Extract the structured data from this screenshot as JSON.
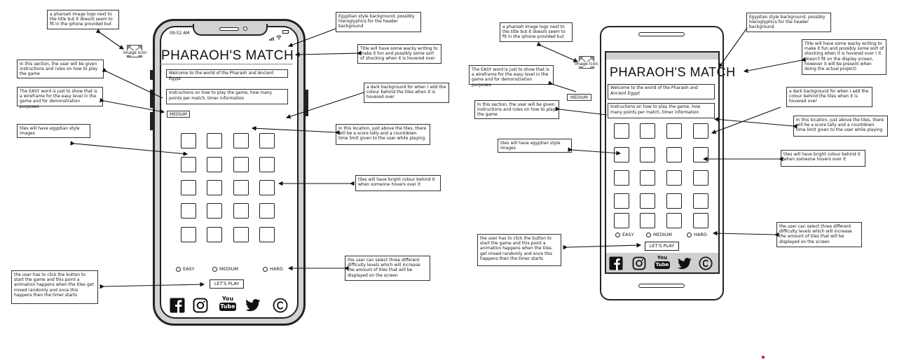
{
  "phone1": {
    "status_time": "09:52 AM",
    "image_icon_label": "Image Icon",
    "title": "PHARAOH'S MATCH",
    "welcome": "Welcome to the world of the Pharaoh and Ancient Egypt",
    "instructions": "Instructions on how to play the game, how many points per match, timer information",
    "level": "MEDIUM",
    "radio_easy": "EASY",
    "radio_medium": "MEDIUM",
    "radio_hard": "HARD",
    "play_button": "LET'S PLAY",
    "youtube_top": "You",
    "youtube_bottom": "Tube"
  },
  "phone2": {
    "image_icon_label": "Image Icon",
    "title": "PHARAOH'S MATCH",
    "welcome": "Welcome to the world of the Pharaoh and Ancient Egypt",
    "instructions": "Instructions on how to play the game, how many points per match, timer information",
    "level": "MEDIUM",
    "radio_easy": "EASY",
    "radio_medium": "MEDIUM",
    "radio_hard": "HARD",
    "play_button": "LET'S PLAY",
    "youtube_top": "You",
    "youtube_bottom": "Tube"
  },
  "notes1": {
    "logo": "a pharoah image logo next to the title but it doesnt seem to fit in the iphone provided but",
    "instructions": "In this section, the user will be given instructions and rules on how to play the game",
    "easy": "The EASY word is just to show that is a wireframe for the easy level in the game and for demonstration purposes",
    "tiles_images": "tiles will have egyptian style images",
    "play": "the user has to click the button to start the game and this point a animation happens when the tiles get mixed randomly and once this happens then the timer starts",
    "background": "Egyptian style background, possibly hieroglyphics for the header background",
    "title": "Title will have some wacky writing to make it fun and possibly some sort of shocking when it is hovered over",
    "dark_bg": "a dark background for when I add the colour behind the tiles when it is hovered over",
    "score": "In this location, just above the tiles, there will be a score tally and a countdown time limit given to the user while playing",
    "hover": "tiles will have bright colour behind it when someone hovers over it",
    "difficulty": "the user can select three different difficulty levels which will increase the amount of tiles that will be displayed on the screen"
  },
  "notes2": {
    "logo": "a pharoah image logo next to the title but it doesnt seem to fit in the iphone provided but",
    "easy": "The EASY word is just to show that is a wireframe for the easy level in the game and for demonstration purposes",
    "instructions": "In this section, the user will be given instructions and rules on how to play the game",
    "tiles_images": "tiles will have egyptian style images",
    "play": "the user has to click the button to start the game and this point a animation happens when the tiles get mixed randomly and once this happens then the timer starts",
    "background": "Egyptian style background, possibly hieroglyphics for the header background",
    "title": "Title will have some wacky writing to make it fun and possibly some sort of shocking when it is hovered over ( it doesn't fit on the display screen, however it will be present when doing the actual project)",
    "dark_bg": "a dark background for when I add the colour behind the tiles when it is hovered over",
    "score": "In this location, just above the tiles, there will be a score tally and a countdown time limit given to the user while playing",
    "hover": "tiles will have bright colour behind it when someone hovers over it",
    "difficulty": "the user can select three different difficulty levels which will increase the amount of tiles that will be displayed on the screen"
  },
  "colors": {
    "ink": "#111111",
    "frame": "#cfcfcf",
    "marker": "#e0001b"
  },
  "icons": [
    "facebook-icon",
    "instagram-icon",
    "youtube-icon",
    "twitter-icon",
    "copyright-icon",
    "image-icon"
  ]
}
